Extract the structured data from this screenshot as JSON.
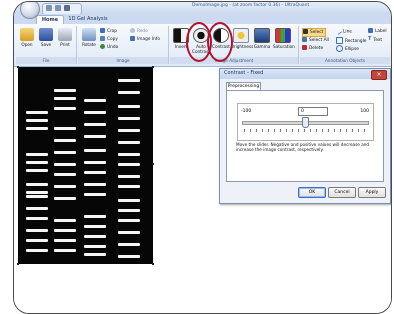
{
  "window": {
    "title": "DemoImage.jpg - (at zoom factor 0.36) - UltraQuant"
  },
  "tabs": [
    "Home",
    "1D Gel Analysis"
  ],
  "ribbon": {
    "file": {
      "label": "File",
      "open": "Open",
      "save": "Save",
      "print": "Print"
    },
    "image": {
      "label": "Image",
      "rotate": "Rotate",
      "crop": "Crop",
      "copy": "Copy",
      "undo": "Undo",
      "redo": "Redo",
      "image_info": "Image Info"
    },
    "adjust": {
      "label": "Image Adjustment",
      "invert": "Invert",
      "auto_contrast": "Auto Contrast",
      "contrast": "Contrast",
      "brightness": "Brightness",
      "gamma": "Gamma",
      "saturation": "Saturation"
    },
    "annot": {
      "label": "Annotation Objects",
      "select": "Select",
      "select_all": "Select All",
      "delete": "Delete",
      "line": "Line",
      "rectangle": "Rectangle",
      "ellipse": "Ellipse",
      "label_btn": "Label",
      "text": "Text"
    }
  },
  "dialog": {
    "title": "Contrast - Fixed",
    "tab": "Preprocessing",
    "min": "-100",
    "max": "100",
    "value": "0",
    "slider_fraction": 0.5,
    "help": "Move the slider.  Negative and positive values will decrease and increase the image contrast, respectively.",
    "ok": "OK",
    "cancel": "Cancel",
    "apply": "Apply"
  },
  "colors": {
    "highlight": "#b1122a",
    "ribbon": "#dfe9f6",
    "gel": "#060606"
  }
}
